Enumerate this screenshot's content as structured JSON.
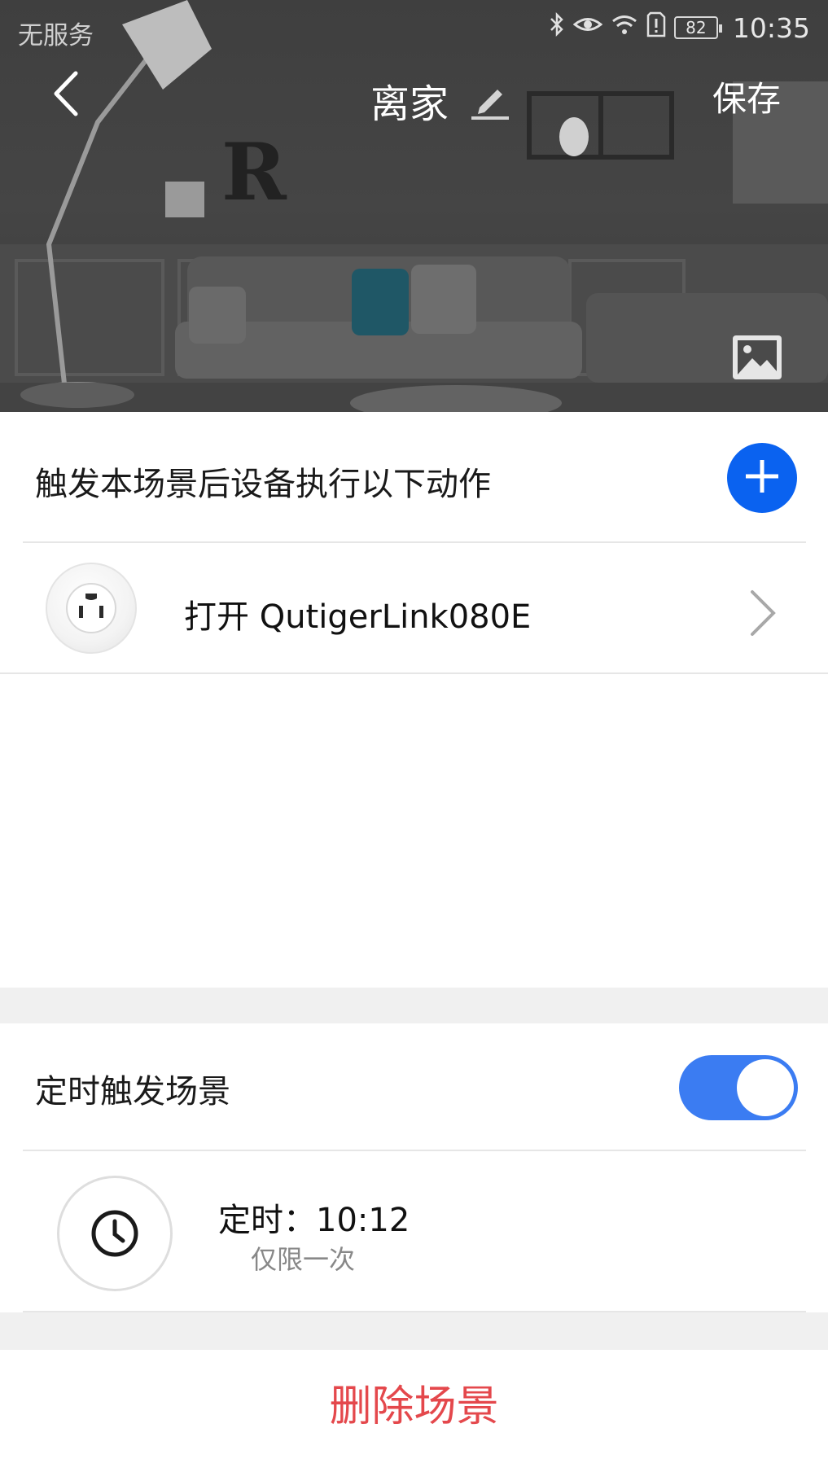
{
  "status_bar": {
    "carrier": "无服务",
    "battery": "82",
    "time": "10:35",
    "icons": [
      "bluetooth-icon",
      "eye-icon",
      "wifi-icon",
      "sim-alert-icon",
      "battery-icon"
    ]
  },
  "header": {
    "title": "离家",
    "save_label": "保存",
    "icons": [
      "back-arrow-icon",
      "pencil-icon",
      "image-icon"
    ]
  },
  "actions_section": {
    "heading": "触发本场景后设备执行以下动作",
    "add_icon": "plus-icon",
    "items": [
      {
        "label": "打开 QutigerLink080E",
        "icon": "smart-plug-icon"
      }
    ]
  },
  "timer_section": {
    "heading": "定时触发场景",
    "toggle_on": true,
    "entry": {
      "time_label": "定时：10:12",
      "repeat_label": "仅限一次",
      "icon": "clock-icon"
    }
  },
  "delete_label": "删除场景",
  "colors": {
    "accent_blue": "#0a62f0",
    "toggle_blue": "#3b7cf2",
    "delete_red": "#e4484c",
    "band_gray": "#f0f0f0"
  }
}
